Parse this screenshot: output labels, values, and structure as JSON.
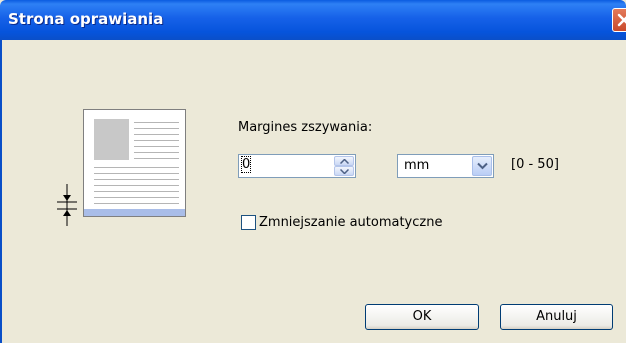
{
  "window": {
    "title": "Strona oprawiania"
  },
  "binding_margin": {
    "label": "Margines zszywania:",
    "value": "0",
    "unit": "mm",
    "range": "[0 - 50]"
  },
  "auto_reduce": {
    "label": "Zmniejszanie automatyczne",
    "checked": false
  },
  "buttons": {
    "ok": "OK",
    "cancel": "Anuluj"
  },
  "icons": {
    "close": "close-icon",
    "spin_up": "chevron-up-icon",
    "spin_down": "chevron-down-icon",
    "dropdown": "chevron-down-icon",
    "illustration": "binding-margin-illustration"
  },
  "colors": {
    "titlebar": "#0a5be0",
    "close": "#d9553a",
    "dialog_bg": "#ece9d8",
    "binding_strip": "#a9bde8"
  }
}
